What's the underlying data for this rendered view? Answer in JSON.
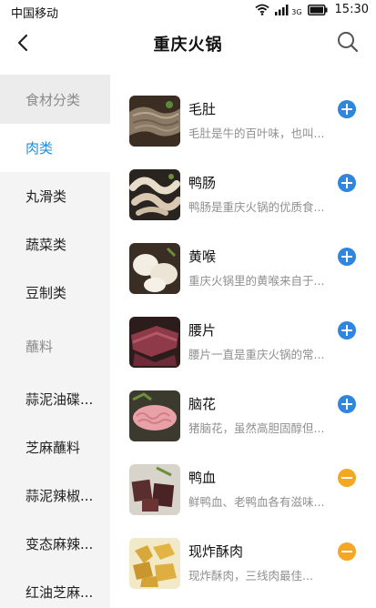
{
  "status_bar": {
    "carrier": "中国移动",
    "network_type": "3G",
    "time": "15:30"
  },
  "header": {
    "title": "重庆火锅",
    "back_icon": "chevron-left-icon",
    "search_icon": "search-icon"
  },
  "sidebar": {
    "ingredients_section": "食材分类",
    "ingredient_categories": [
      {
        "label": "肉类",
        "active": true
      },
      {
        "label": "丸滑类",
        "active": false
      },
      {
        "label": "蔬菜类",
        "active": false
      },
      {
        "label": "豆制类",
        "active": false
      }
    ],
    "dips_section": "蘸料",
    "dips": [
      {
        "label": "蒜泥油碟..."
      },
      {
        "label": "芝麻蘸料"
      },
      {
        "label": "蒜泥辣椒..."
      },
      {
        "label": "变态麻辣..."
      },
      {
        "label": "红油芝麻..."
      }
    ]
  },
  "food_list": [
    {
      "name": "毛肚",
      "desc": "毛肚是牛的百叶味，也叫...",
      "button": "plus",
      "color": "#2e86de"
    },
    {
      "name": "鸭肠",
      "desc": "鸭肠是重庆火锅的优质食...",
      "button": "plus",
      "color": "#2e86de"
    },
    {
      "name": "黄喉",
      "desc": "重庆火锅里的黄喉来自于...",
      "button": "plus",
      "color": "#2e86de"
    },
    {
      "name": "腰片",
      "desc": "腰片一直是重庆火锅的常...",
      "button": "plus",
      "color": "#2e86de"
    },
    {
      "name": "脑花",
      "desc": "猪脑花，虽然高胆固醇但...",
      "button": "plus",
      "color": "#2e86de"
    },
    {
      "name": "鸭血",
      "desc": "鲜鸭血、老鸭血各有滋味...",
      "button": "minus",
      "color": "#f5a623"
    },
    {
      "name": "现炸酥肉",
      "desc": "现炸酥肉，三线肉最佳...",
      "button": "minus",
      "color": "#f5a623"
    }
  ],
  "colors": {
    "accent": "#1f8ce0",
    "add_button": "#2e86de",
    "remove_button": "#f5a623"
  }
}
